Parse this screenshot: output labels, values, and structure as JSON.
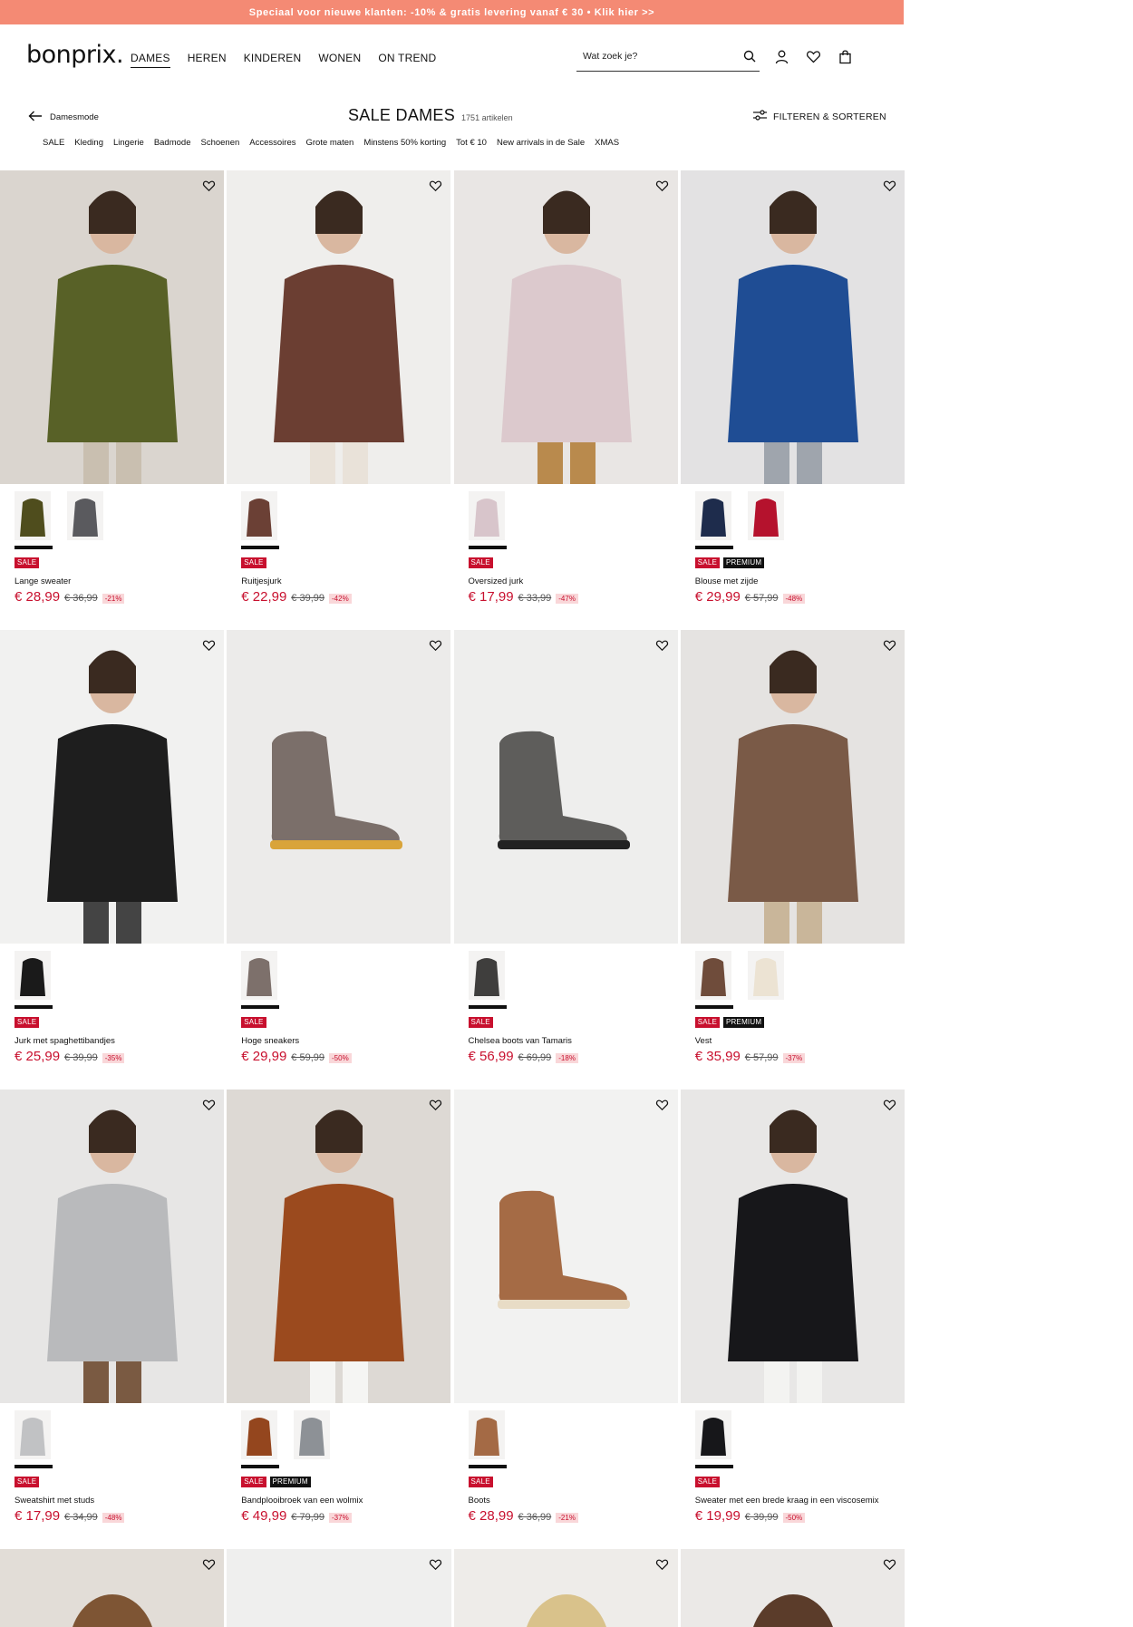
{
  "promo": {
    "text": "Speciaal voor nieuwe klanten: -10% & gratis levering vanaf € 30 • Klik hier >>"
  },
  "header": {
    "logo": "bonprix.",
    "nav": [
      "DAMES",
      "HEREN",
      "KINDEREN",
      "WONEN",
      "ON TREND"
    ],
    "active_nav": "DAMES",
    "search_placeholder": "Wat zoek je?",
    "icons": [
      "search-icon",
      "account-icon",
      "wishlist-icon",
      "cart-icon"
    ]
  },
  "titlebar": {
    "back_label": "Damesmode",
    "title": "SALE DAMES",
    "count": "1751 artikelen",
    "filter_label": "FILTEREN & SORTEREN"
  },
  "categories": [
    "SALE",
    "Kleding",
    "Lingerie",
    "Badmode",
    "Schoenen",
    "Accessoires",
    "Grote maten",
    "Minstens 50% korting",
    "Tot € 10",
    "New arrivals in de Sale",
    "XMAS"
  ],
  "colors": {
    "accent": "#c8102e",
    "promo": "#f48a74",
    "discount_bg": "#f9d7d9"
  },
  "products": [
    {
      "name": "Lange sweater",
      "price": "€ 28,99",
      "old_price": "€ 36,99",
      "discount": "-21%",
      "badges": [
        "SALE"
      ],
      "img": {
        "bg": "#dad5cf",
        "figure": "#586127",
        "accent": "#c9bfb0"
      },
      "swatches": [
        {
          "color": "#4f4d1d"
        },
        {
          "color": "#5a5a5e"
        }
      ]
    },
    {
      "name": "Ruitjesjurk",
      "price": "€ 22,99",
      "old_price": "€ 39,99",
      "discount": "-42%",
      "badges": [
        "SALE"
      ],
      "img": {
        "bg": "#efeeec",
        "figure": "#6b3e32",
        "accent": "#e9e2d9"
      },
      "swatches": [
        {
          "color": "#6b4035"
        }
      ]
    },
    {
      "name": "Oversized jurk",
      "price": "€ 17,99",
      "old_price": "€ 33,99",
      "discount": "-47%",
      "badges": [
        "SALE"
      ],
      "img": {
        "bg": "#e9e6e4",
        "figure": "#dcc9cd",
        "accent": "#b98a4d"
      },
      "swatches": [
        {
          "color": "#d8c5cb"
        }
      ]
    },
    {
      "name": "Blouse met zijde",
      "price": "€ 29,99",
      "old_price": "€ 57,99",
      "discount": "-48%",
      "badges": [
        "SALE",
        "PREMIUM"
      ],
      "img": {
        "bg": "#e3e2e3",
        "figure": "#1f4d94",
        "accent": "#9fa5ad"
      },
      "swatches": [
        {
          "color": "#1e2c4c"
        },
        {
          "color": "#b5122d"
        }
      ]
    },
    {
      "name": "Jurk met spaghettibandjes",
      "price": "€ 25,99",
      "old_price": "€ 39,99",
      "discount": "-35%",
      "badges": [
        "SALE"
      ],
      "img": {
        "bg": "#f1f1f0",
        "figure": "#1e1e1e",
        "accent": "#444"
      },
      "swatches": [
        {
          "color": "#1a1a1a"
        }
      ]
    },
    {
      "name": "Hoge sneakers",
      "price": "€ 29,99",
      "old_price": "€ 59,99",
      "discount": "-50%",
      "badges": [
        "SALE"
      ],
      "img": {
        "bg": "#ecebea",
        "figure": "#7b6f6a",
        "accent": "#d9a43a"
      },
      "swatches": [
        {
          "color": "#7d706b"
        }
      ]
    },
    {
      "name": "Chelsea boots van Tamaris",
      "price": "€ 56,99",
      "old_price": "€ 69,99",
      "discount": "-18%",
      "badges": [
        "SALE"
      ],
      "img": {
        "bg": "#eeeeed",
        "figure": "#5e5d5b",
        "accent": "#222"
      },
      "swatches": [
        {
          "color": "#3f3e3d"
        }
      ]
    },
    {
      "name": "Vest",
      "price": "€ 35,99",
      "old_price": "€ 57,99",
      "discount": "-37%",
      "badges": [
        "SALE",
        "PREMIUM"
      ],
      "img": {
        "bg": "#e5e3e1",
        "figure": "#7a5a47",
        "accent": "#c9b69a"
      },
      "swatches": [
        {
          "color": "#6f4c3b"
        },
        {
          "color": "#ece3d3"
        }
      ]
    },
    {
      "name": "Sweatshirt met studs",
      "price": "€ 17,99",
      "old_price": "€ 34,99",
      "discount": "-48%",
      "badges": [
        "SALE"
      ],
      "img": {
        "bg": "#e7e6e5",
        "figure": "#b9babc",
        "accent": "#7a5a42"
      },
      "swatches": [
        {
          "color": "#c1c2c4"
        }
      ]
    },
    {
      "name": "Bandplooibroek van een wolmix",
      "price": "€ 49,99",
      "old_price": "€ 79,99",
      "discount": "-37%",
      "badges": [
        "SALE",
        "PREMIUM"
      ],
      "img": {
        "bg": "#ddd9d4",
        "figure": "#9b4a1e",
        "accent": "#f5f5f3"
      },
      "swatches": [
        {
          "color": "#94461e"
        },
        {
          "color": "#8d9196"
        }
      ]
    },
    {
      "name": "Boots",
      "price": "€ 28,99",
      "old_price": "€ 36,99",
      "discount": "-21%",
      "badges": [
        "SALE"
      ],
      "img": {
        "bg": "#f2f2f1",
        "figure": "#a56b45",
        "accent": "#e8dcc6"
      },
      "swatches": [
        {
          "color": "#a46a45"
        }
      ]
    },
    {
      "name": "Sweater met een brede kraag in een viscosemix",
      "price": "€ 19,99",
      "old_price": "€ 39,99",
      "discount": "-50%",
      "badges": [
        "SALE"
      ],
      "img": {
        "bg": "#e8e7e6",
        "figure": "#17171a",
        "accent": "#f3f3f1"
      },
      "swatches": [
        {
          "color": "#17171a"
        }
      ]
    }
  ],
  "partial_row": [
    {
      "img": {
        "bg": "#e2ddd7",
        "figure": "#7e5534"
      }
    },
    {
      "img": {
        "bg": "#efefee",
        "figure": "#e6e6e5"
      }
    },
    {
      "img": {
        "bg": "#eeece9",
        "figure": "#d9c28b"
      }
    },
    {
      "img": {
        "bg": "#ebe9e7",
        "figure": "#5b3c2a"
      }
    }
  ]
}
